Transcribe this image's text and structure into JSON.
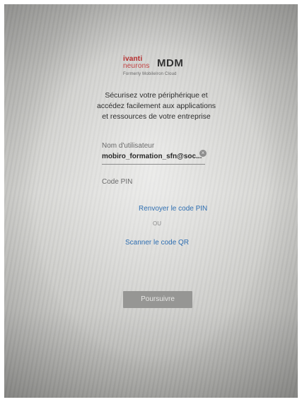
{
  "logo": {
    "brand_line1": "ivanti",
    "brand_line2": "neurons",
    "product": "MDM",
    "subtitle": "Formerly MobileIron Cloud"
  },
  "intro": {
    "text": "Sécurisez votre périphérique et accédez facilement aux applications et ressources de votre entreprise"
  },
  "form": {
    "username_label": "Nom d'utilisateur",
    "username_value": "mobiro_formation_sfn@soc...",
    "pin_label": "Code PIN",
    "pin_value": ""
  },
  "links": {
    "resend_pin": "Renvoyer le code PIN",
    "or": "OU",
    "scan_qr": "Scanner le code QR"
  },
  "actions": {
    "continue": "Poursuivre"
  },
  "colors": {
    "link": "#2f6fb2",
    "brand_red": "#b52a2a",
    "button_disabled": "#969694"
  }
}
